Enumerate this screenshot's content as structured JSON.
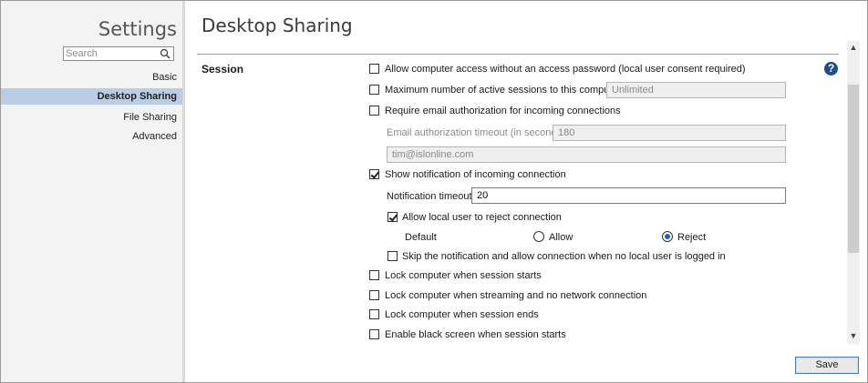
{
  "sidebar": {
    "title": "Settings",
    "search_placeholder": "Search",
    "items": [
      {
        "label": "Basic"
      },
      {
        "label": "Desktop Sharing"
      },
      {
        "label": "File Sharing"
      },
      {
        "label": "Advanced"
      }
    ],
    "selected_index": 1
  },
  "main": {
    "title": "Desktop Sharing",
    "section": "Session",
    "help_icon": "?",
    "options": {
      "allow_no_password": {
        "label": "Allow computer access without an access password (local user consent required)",
        "checked": false
      },
      "max_sessions": {
        "label": "Maximum number of active sessions to this computer",
        "checked": false,
        "value": "Unlimited"
      },
      "require_email": {
        "label": "Require email authorization for incoming connections",
        "checked": false
      },
      "email_timeout": {
        "label": "Email authorization timeout (in seconds)",
        "value": "180"
      },
      "email_address": {
        "value": "tim@islonline.com"
      },
      "show_notification": {
        "label": "Show notification of incoming connection",
        "checked": true
      },
      "notification_timeout": {
        "label": "Notification timeout",
        "value": "20"
      },
      "allow_reject": {
        "label": "Allow local user to reject connection",
        "checked": true
      },
      "default_choice": {
        "label": "Default",
        "allow_label": "Allow",
        "reject_label": "Reject",
        "selected": "Reject"
      },
      "skip_notification": {
        "label": "Skip the notification and allow connection when no local user is logged in",
        "checked": false
      },
      "lock_on_start": {
        "label": "Lock computer when session starts",
        "checked": false
      },
      "lock_no_network": {
        "label": "Lock computer when streaming and no network connection",
        "checked": false
      },
      "lock_on_end": {
        "label": "Lock computer when session ends",
        "checked": false
      },
      "black_screen": {
        "label": "Enable black screen when session starts",
        "checked": false
      }
    },
    "save_label": "Save"
  },
  "colors": {
    "selected_nav": "#b9cde5",
    "help_icon": "#1f4e8a",
    "radio_dot": "#1e63c4"
  }
}
